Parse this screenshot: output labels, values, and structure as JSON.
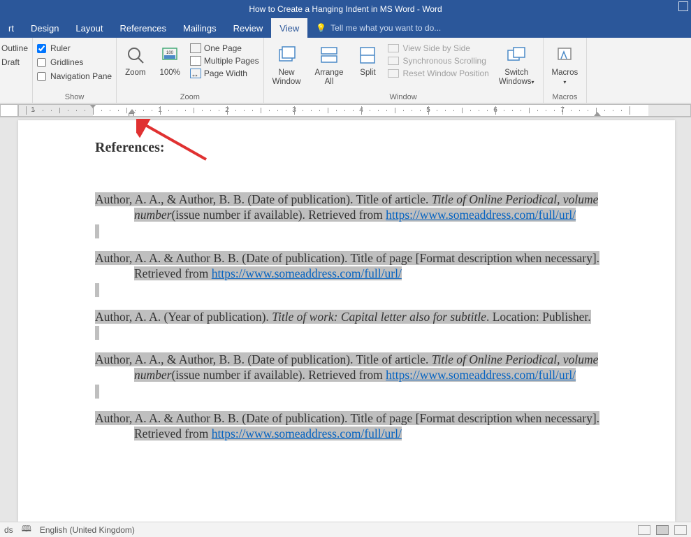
{
  "title": "How to Create a Hanging Indent in MS Word - Word",
  "tabs": {
    "insert_partial": "rt",
    "design": "Design",
    "layout": "Layout",
    "references": "References",
    "mailings": "Mailings",
    "review": "Review",
    "view": "View"
  },
  "tellme": "Tell me what you want to do...",
  "views": {
    "outline": "Outline",
    "draft": "Draft"
  },
  "show": {
    "ruler": "Ruler",
    "gridlines": "Gridlines",
    "navpane": "Navigation Pane",
    "group": "Show"
  },
  "zoom": {
    "zoom": "Zoom",
    "hundred": "100%",
    "onepage": "One Page",
    "multipages": "Multiple Pages",
    "pagewidth": "Page Width",
    "group": "Zoom"
  },
  "window": {
    "newwindow": "New\nWindow",
    "arrange": "Arrange\nAll",
    "split": "Split",
    "sidebyside": "View Side by Side",
    "syncscroll": "Synchronous Scrolling",
    "resetpos": "Reset Window Position",
    "switch": "Switch\nWindows",
    "group": "Window"
  },
  "macros": {
    "macros": "Macros",
    "group": "Macros"
  },
  "ruler_nums": [
    "1",
    "1",
    "2",
    "3",
    "4",
    "5",
    "6",
    "7"
  ],
  "doc": {
    "heading": "References:",
    "entries": [
      {
        "pre": "Author, A. A., & Author, B. B. (Date of publication). Title of article. ",
        "ital": "Title of Online Periodical, volume number",
        "mid": "(issue number if available). Retrieved from ",
        "link": "https://www.someaddress.com/full/url/"
      },
      {
        "pre": "Author, A. A. & Author B. B. (Date of publication). Title of page [Format description when necessary]. Retrieved from ",
        "link": "https://www.someaddress.com/full/url/"
      },
      {
        "pre": "Author, A. A. (Year of publication). ",
        "ital": "Title of work: Capital letter also for subtitle",
        "mid": ". Location: Publisher."
      },
      {
        "pre": "Author, A. A., & Author, B. B. (Date of publication). Title of article. ",
        "ital": "Title of Online Periodical, volume number",
        "mid": "(issue number if available). Retrieved from ",
        "link": "https://www.someaddress.com/full/url/"
      },
      {
        "pre": "Author, A. A. & Author B. B. (Date of publication). Title of page [Format description when necessary]. Retrieved from ",
        "link": "https://www.someaddress.com/full/url/"
      }
    ]
  },
  "status": {
    "ds": "ds",
    "lang": "English (United Kingdom)"
  }
}
